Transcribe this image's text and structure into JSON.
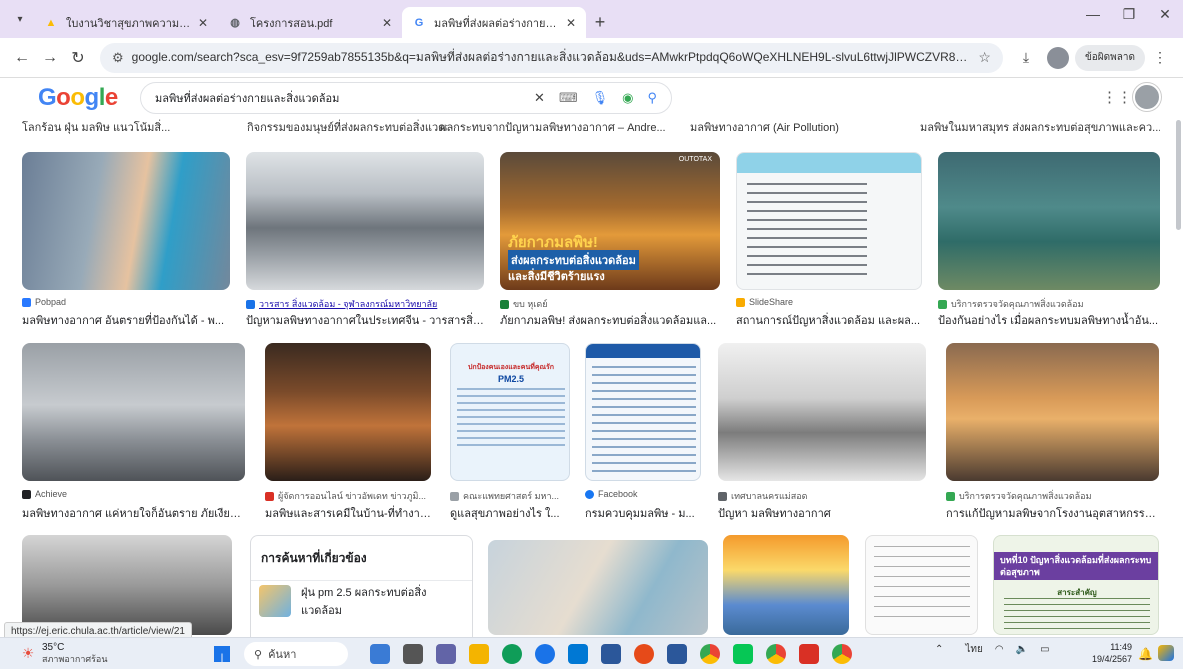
{
  "browser": {
    "tabs": [
      {
        "icon": "drive-icon",
        "title": "ใบงานวิชาสุขภาพความปลอดภัยและ"
      },
      {
        "icon": "web-icon",
        "title": "โครงการสอน.pdf"
      },
      {
        "icon": "google-icon",
        "title": "มลพิษที่ส่งผลต่อร่างกายและสิ่งแวดล้อ"
      }
    ],
    "url": "google.com/search?sca_esv=9f7259ab7855135b&q=มลพิษที่ส่งผลต่อร่างกายและสิ่งแวดล้อม&uds=AMwkrPtpdqQ6oWQeXHLNEH9L-slvuL6ttwjJlPWCZVR8EmZmKJeyq_3VoOljllEx7Tkj7JFLdSp...",
    "profile_label": "ข้อผิดพลาด"
  },
  "google": {
    "logo": "Google",
    "query": "มลพิษที่ส่งผลต่อร่างกายและสิ่งแวดล้อม"
  },
  "top_captions": [
    "โลกร้อน ฝุ่น มลพิษ แนวโน้มสิ่...",
    "กิจกรรมของมนุษย์ที่ส่งผลกระทบต่อสิ่งแวดล้อม...",
    "ผลกระทบจากปัญหามลพิษทางอากาศ – Andre...",
    "มลพิษทางอากาศ (Air Pollution)",
    "มลพิษในมหาสมุทร ส่งผลกระทบต่อสุขภาพและคว..."
  ],
  "row1": [
    {
      "source": "Pobpad",
      "caption": "มลพิษทางอากาศ อันตรายที่ป้องกันได้ - พ...",
      "src_color": "#2979ff"
    },
    {
      "source": "วารสาร สิ่งแวดล้อม - จุฬาลงกรณ์มหาวิทยาลัย",
      "caption": "ปัญหามลพิษทางอากาศในประเทศจีน - วารสารสิ่ง...",
      "src_color": "#1a73e8"
    },
    {
      "source": "ขบ หุเดย์",
      "caption": "ภัยกาภมลพิษ! ส่งผลกระทบต่อสิ่งแวดล้อมแล...",
      "src_color": "#188038"
    },
    {
      "source": "SlideShare",
      "caption": "สถานการณ์ปัญหาสิ่งแวดล้อม และผล...",
      "src_color": "#f9ab00"
    },
    {
      "source": "บริการตรวจวัดคุณภาพสิ่งแวดล้อม",
      "caption": "ป้องกันอย่างไร เมื่อผลกระทบมลพิษทางน้ำอัน...",
      "src_color": "#34a853"
    }
  ],
  "row1_overlay": {
    "line1": "ภัยกาภมลพิษ!",
    "line2": "ส่งผลกระทบต่อสิ่งแวดล้อม",
    "line3": "และสิ่งมีชีวิตร้ายแรง",
    "brand": "OUTOTAX"
  },
  "row2": [
    {
      "source": "Achieve",
      "caption": "มลพิษทางอากาศ แค่หายใจก็อันตราย ภัยเงียบ...",
      "src_color": "#202124"
    },
    {
      "source": "ผู้จัดการออนไลน์ ข่าวอัพเดท ข่าวภูมิ...",
      "caption": "มลพิษและสารเคมีในบ้าน-ที่ทำงาน...",
      "src_color": "#d93025"
    },
    {
      "source": "คณะแพทยศาสตร์ มหา...",
      "caption": "ดูแลสุขภาพอย่างไร ใ...",
      "src_color": "#9aa0a6"
    },
    {
      "source": "Facebook",
      "caption": "กรมควบคุมมลพิษ - ม...",
      "src_color": "#1877f2"
    },
    {
      "source": "เทศบาลนครแม่สอด",
      "caption": "ปัญหา มลพิษทางอากาศ",
      "src_color": "#5f6368"
    },
    {
      "source": "บริการตรวจวัดคุณภาพสิ่งแวดล้อม",
      "caption": "การแก้ปัญหามลพิษจากโรงงานอุตสาหกรรม...",
      "src_color": "#34a853"
    }
  ],
  "poster": {
    "heading": "ปกป้องคนเองและคนที่คุณรัก",
    "pm": "PM2.5"
  },
  "related": {
    "heading": "การค้นหาที่เกี่ยวข้อง",
    "items": [
      "ฝุ่น pm 2.5 ผลกระทบต่อสิ่งแวดล้อม"
    ]
  },
  "row3_text": {
    "banner": "บทที่10 ปัญหาสิ่งแวดล้อมที่ส่งผลกระทบต่อสุขภาพ",
    "sub": "สาระสำคัญ"
  },
  "status_url": "https://ej.eric.chula.ac.th/article/view/21",
  "taskbar": {
    "temp": "35°C",
    "weather": "สภาพอากาศร้อน",
    "search_placeholder": "ค้นหา",
    "lang": "ไทย",
    "time": "11:49",
    "date": "19/4/2567"
  },
  "colors": {
    "tabbar": "#e8dff5",
    "taskbar": "#e9eef6",
    "accent": "#1a73e8"
  }
}
